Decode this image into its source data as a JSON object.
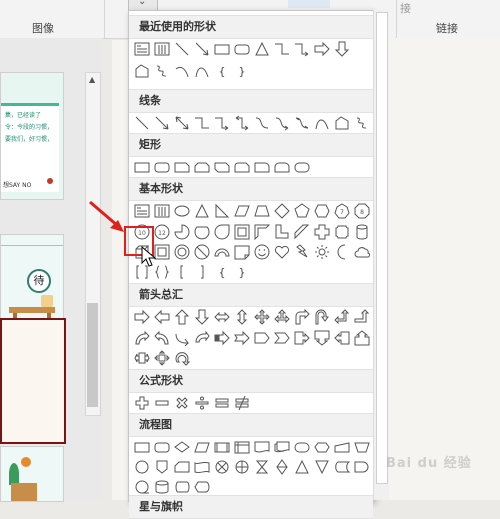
{
  "ribbon": {
    "groups": [
      {
        "label": "图像"
      },
      {
        "label": "链接"
      }
    ],
    "partial_button_label": "接"
  },
  "thumbnails": {
    "slide1": {
      "line1": "集，已经读了",
      "line2": "令：今段的习惯，",
      "line3": "要我们，好习惯，",
      "line4": "想SAY NO"
    },
    "slide2": {
      "badge": "待"
    }
  },
  "dropdown": {
    "sections": [
      {
        "title": "最近使用的形状"
      },
      {
        "title": "线条"
      },
      {
        "title": "矩形"
      },
      {
        "title": "基本形状"
      },
      {
        "title": "箭头总汇"
      },
      {
        "title": "公式形状"
      },
      {
        "title": "流程图"
      },
      {
        "title": "星与旗帜"
      }
    ],
    "text_glyphs": {
      "brace_open": "{",
      "brace_close": "}"
    }
  },
  "watermark": "Bai du 经验",
  "colors": {
    "highlight": "#e0201c",
    "slide_border": "#7a1414",
    "arrow": "#e0201c"
  }
}
